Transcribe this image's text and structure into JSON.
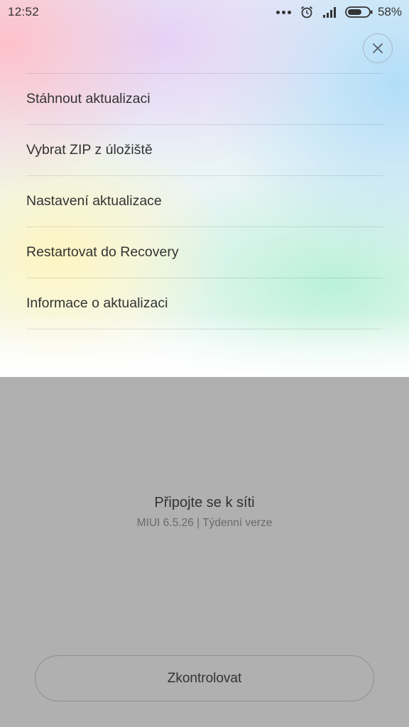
{
  "status_bar": {
    "time": "12:52",
    "icons": [
      "more-dots-icon",
      "alarm-clock-icon",
      "signal-icon",
      "battery-icon"
    ],
    "battery_percent": "58%"
  },
  "close_button": {
    "icon": "close-icon"
  },
  "menu": {
    "items": [
      {
        "label": "Stáhnout aktualizaci"
      },
      {
        "label": "Vybrat ZIP z úložiště"
      },
      {
        "label": "Nastavení aktualizace"
      },
      {
        "label": "Restartovat do Recovery"
      },
      {
        "label": "Informace o aktualizaci"
      }
    ]
  },
  "info": {
    "title": "Připojte se k síti",
    "subtitle": "MIUI 6.5.26 | Týdenní verze"
  },
  "check_button": {
    "label": "Zkontrolovat"
  },
  "colors": {
    "bottom_overlay": "#b0b0b0",
    "text": "#333333",
    "subtext": "#6a6a6a"
  }
}
